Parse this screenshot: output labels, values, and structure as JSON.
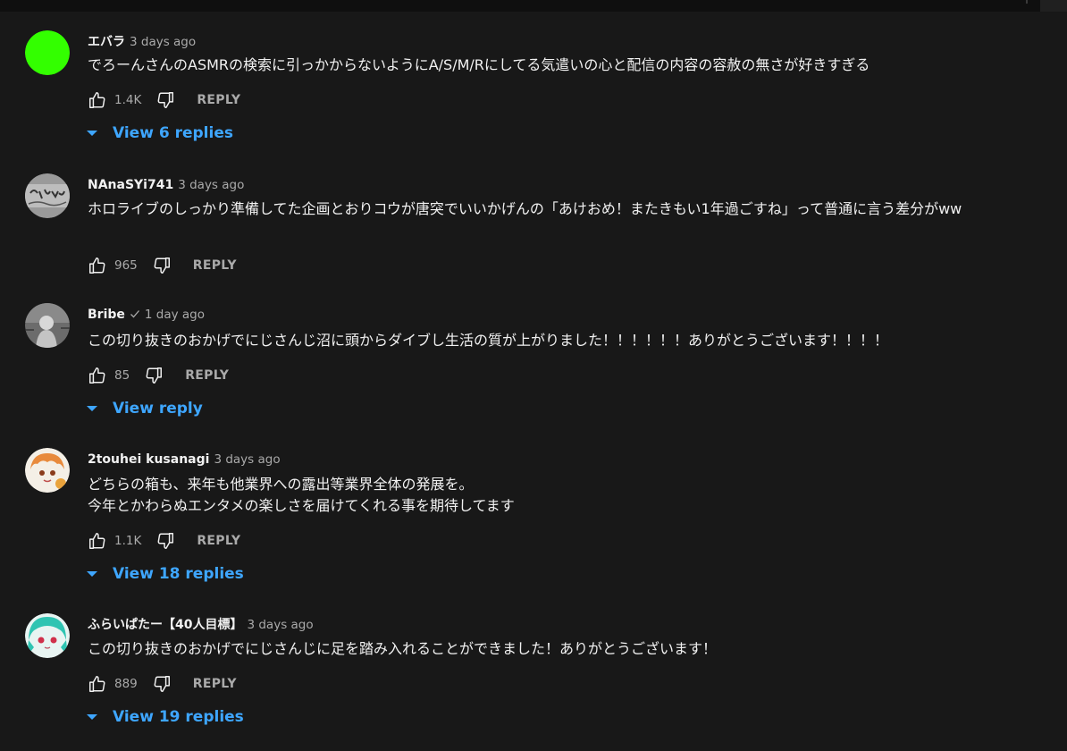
{
  "colors": {
    "background": "#181818",
    "text": "#f1f1f1",
    "secondary": "#aaaaaa",
    "link": "#3ea6ff"
  },
  "comments": [
    {
      "author": "エバラ",
      "time": "3 days ago",
      "text": "でろーんさんのASMRの検索に引っかからないようにA/S/M/Rにしてる気遣いの心と配信の内容の容赦の無さが好きすぎる",
      "likes": "1.4K",
      "reply_label": "REPLY",
      "replies_label": "View 6 replies",
      "avatar": "green-circle-avatar"
    },
    {
      "author": "NAnaSYi741",
      "time": "3 days ago",
      "text": "ホロライブのしっかり準備してた企画とおりコウが唐突でいいかげんの「あけおめ！またきもい1年過ごすね」って普通に言う差分がww",
      "likes": "965",
      "reply_label": "REPLY",
      "avatar": "graffiti-avatar"
    },
    {
      "author": "Bribe",
      "verified": true,
      "time": "1 day ago",
      "text": "この切り抜きのおかげでにじさんじ沼に頭からダイブし生活の質が上がりました！！！！！！ありがとうございます！！！！",
      "likes": "85",
      "reply_label": "REPLY",
      "replies_label": "View reply",
      "avatar": "figure-avatar"
    },
    {
      "author": "2touhei kusanagi",
      "time": "3 days ago",
      "text_lines": [
        "どちらの箱も、来年も他業界への露出等業界全体の発展を。",
        "今年とかわらぬエンタメの楽しさを届けてくれる事を期待してます"
      ],
      "likes": "1.1K",
      "reply_label": "REPLY",
      "replies_label": "View 18 replies",
      "avatar": "anime-girl-avatar"
    },
    {
      "author": "ふらいぱたー【40人目標】",
      "time": "3 days ago",
      "text": "この切り抜きのおかげでにじさんじに足を踏み入れることができました！ありがとうございます！",
      "likes": "889",
      "reply_label": "REPLY",
      "replies_label": "View 19 replies",
      "avatar": "teal-hair-avatar"
    }
  ],
  "icons": {
    "like": "thumbs-up-icon",
    "dislike": "thumbs-down-icon",
    "expand": "caret-down-icon",
    "verified": "checkmark-icon"
  }
}
